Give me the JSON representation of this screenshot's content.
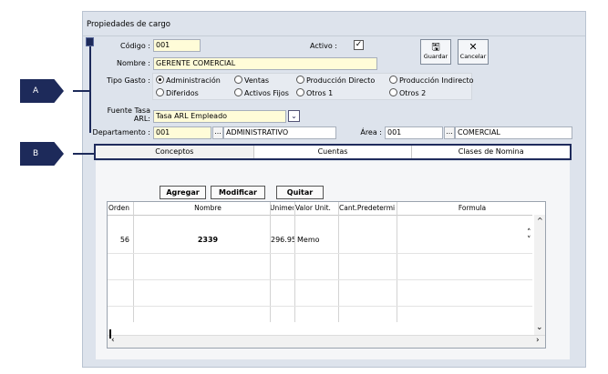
{
  "window": {
    "title": "Propiedades de cargo"
  },
  "form": {
    "codigo_label": "Código :",
    "codigo_value": "001",
    "activo_label": "Activo :",
    "activo_checked": true,
    "nombre_label": "Nombre :",
    "nombre_value": "GERENTE COMERCIAL",
    "tipo_gasto_label": "Tipo Gasto :",
    "tipo_gasto_options": [
      "Administración",
      "Ventas",
      "Producción Directo",
      "Producción Indirecto",
      "Diferidos",
      "Activos Fijos",
      "Otros 1",
      "Otros 2"
    ],
    "tipo_gasto_selected": "Administración",
    "fuente_tasa_label_1": "Fuente Tasa",
    "fuente_tasa_label_2": "ARL:",
    "fuente_tasa_value": "Tasa ARL Empleado",
    "departamento_label": "Departamento :",
    "departamento_code": "001",
    "departamento_name": "ADMINISTRATIVO",
    "area_label": "Área :",
    "area_code": "001",
    "area_name": "COMERCIAL",
    "lookup_dots": "..."
  },
  "toolbar": {
    "save_label": "Guardar",
    "cancel_label": "Cancelar"
  },
  "tabs": [
    {
      "label": "Conceptos",
      "active": true
    },
    {
      "label": "Cuentas",
      "active": false
    },
    {
      "label": "Clases de Nomina",
      "active": false
    }
  ],
  "actions": {
    "add_label": "Agregar",
    "modify_label": "Modificar",
    "remove_label": "Quitar"
  },
  "grid": {
    "columns": [
      "Orden",
      "Nombre",
      "Unimed",
      "Valor Unit.",
      "Cant.Predetermi",
      "Formula"
    ],
    "rows": [
      {
        "orden": "56",
        "nombre": "2339",
        "unimed": "296.95",
        "valor": "Memo",
        "cant": "",
        "formula": ""
      }
    ]
  },
  "annotations": {
    "a": "A",
    "b": "B"
  },
  "colors": {
    "callout": "#1d2a5a",
    "field_yellow": "#fffcd8",
    "window_bg": "#dde3ec"
  }
}
